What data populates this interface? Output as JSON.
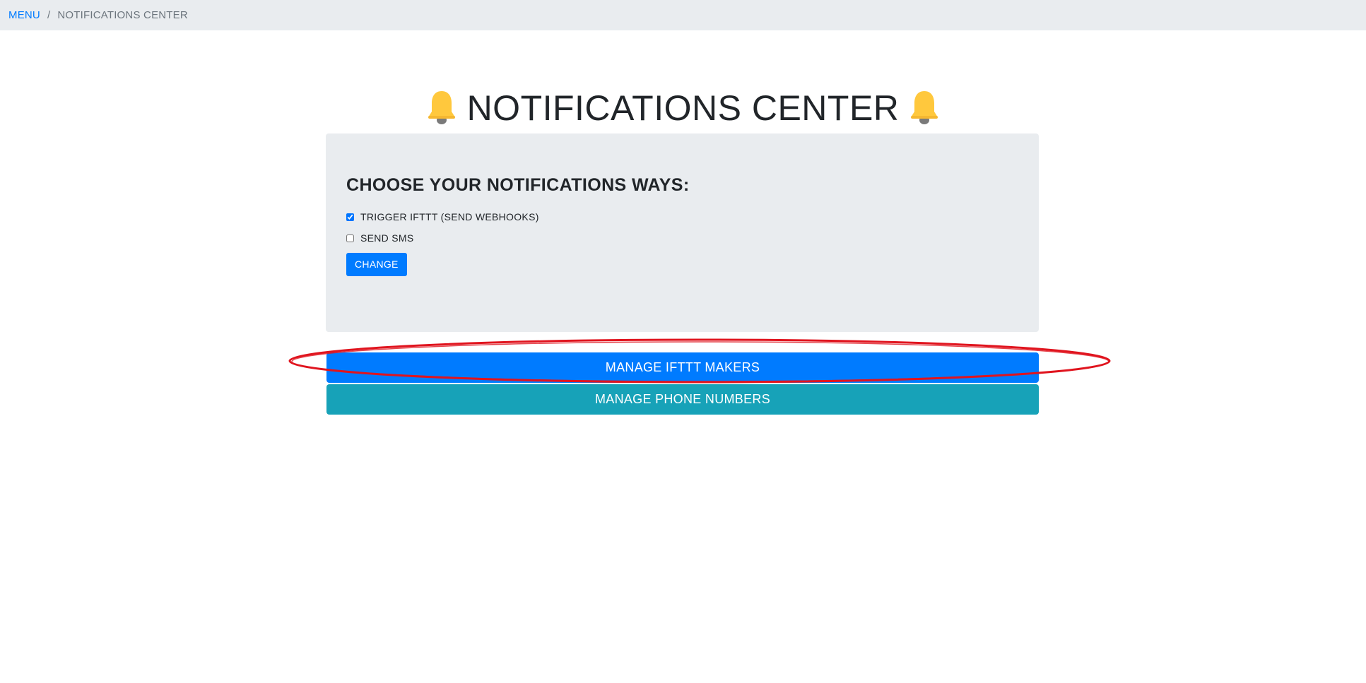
{
  "breadcrumb": {
    "menu_label": "MENU",
    "separator": "/",
    "current_label": "NOTIFICATIONS CENTER"
  },
  "header": {
    "title": "NOTIFICATIONS CENTER",
    "icon": "bell-icon",
    "icon_color": "#FFC83D"
  },
  "card": {
    "heading": "CHOOSE YOUR NOTIFICATIONS WAYS:",
    "options": [
      {
        "label": "TRIGGER IFTTT (SEND WEBHOOKS)",
        "checked": true
      },
      {
        "label": "SEND SMS",
        "checked": false
      }
    ],
    "submit_label": "CHANGE"
  },
  "actions": {
    "manage_iftt_label": "MANAGE IFTTT MAKERS",
    "manage_phone_label": "MANAGE PHONE NUMBERS"
  },
  "colors": {
    "primary": "#007bff",
    "info": "#17a2b8",
    "panel": "#e9ecef",
    "annotation": "#e0141e"
  }
}
